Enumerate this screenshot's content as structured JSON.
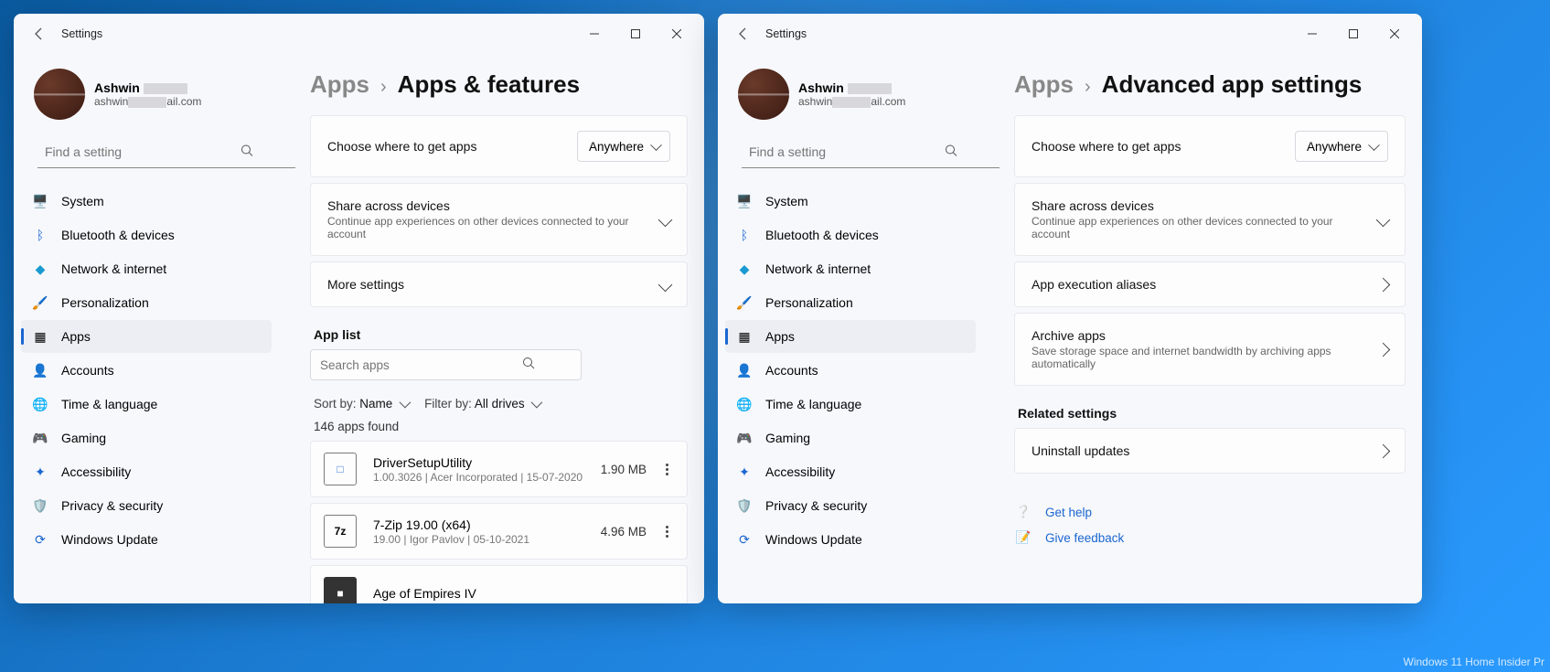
{
  "common": {
    "app_title": "Settings",
    "user_name": "Ashwin",
    "user_email_prefix": "ashwin",
    "user_email_suffix": "ail.com",
    "search_placeholder": "Find a setting",
    "nav": [
      {
        "label": "System"
      },
      {
        "label": "Bluetooth & devices"
      },
      {
        "label": "Network & internet"
      },
      {
        "label": "Personalization"
      },
      {
        "label": "Apps"
      },
      {
        "label": "Accounts"
      },
      {
        "label": "Time & language"
      },
      {
        "label": "Gaming"
      },
      {
        "label": "Accessibility"
      },
      {
        "label": "Privacy & security"
      },
      {
        "label": "Windows Update"
      }
    ]
  },
  "left": {
    "bc_parent": "Apps",
    "bc_current": "Apps & features",
    "where_label": "Choose where to get apps",
    "where_value": "Anywhere",
    "share_title": "Share across devices",
    "share_sub": "Continue app experiences on other devices connected to your account",
    "more_settings": "More settings",
    "app_list_h": "App list",
    "search_apps_ph": "Search apps",
    "sort_label": "Sort by:",
    "sort_value": "Name",
    "filter_label": "Filter by:",
    "filter_value": "All drives",
    "apps_found": "146 apps found",
    "apps": [
      {
        "name": "DriverSetupUtility",
        "meta": "1.00.3026  |  Acer Incorporated  |  15-07-2020",
        "size": "1.90 MB",
        "icon_text": "□"
      },
      {
        "name": "7-Zip 19.00 (x64)",
        "meta": "19.00  |  Igor Pavlov  |  05-10-2021",
        "size": "4.96 MB",
        "icon_text": "7z"
      },
      {
        "name": "Age of Empires IV",
        "meta": "",
        "size": "",
        "icon_text": "■"
      }
    ]
  },
  "right": {
    "bc_parent": "Apps",
    "bc_current": "Advanced app settings",
    "where_label": "Choose where to get apps",
    "where_value": "Anywhere",
    "share_title": "Share across devices",
    "share_sub": "Continue app experiences on other devices connected to your account",
    "aliases": "App execution aliases",
    "archive_title": "Archive apps",
    "archive_sub": "Save storage space and internet bandwidth by archiving apps automatically",
    "related_h": "Related settings",
    "uninstall": "Uninstall updates",
    "get_help": "Get help",
    "give_feedback": "Give feedback"
  },
  "watermark": "Windows 11 Home Insider Pr"
}
